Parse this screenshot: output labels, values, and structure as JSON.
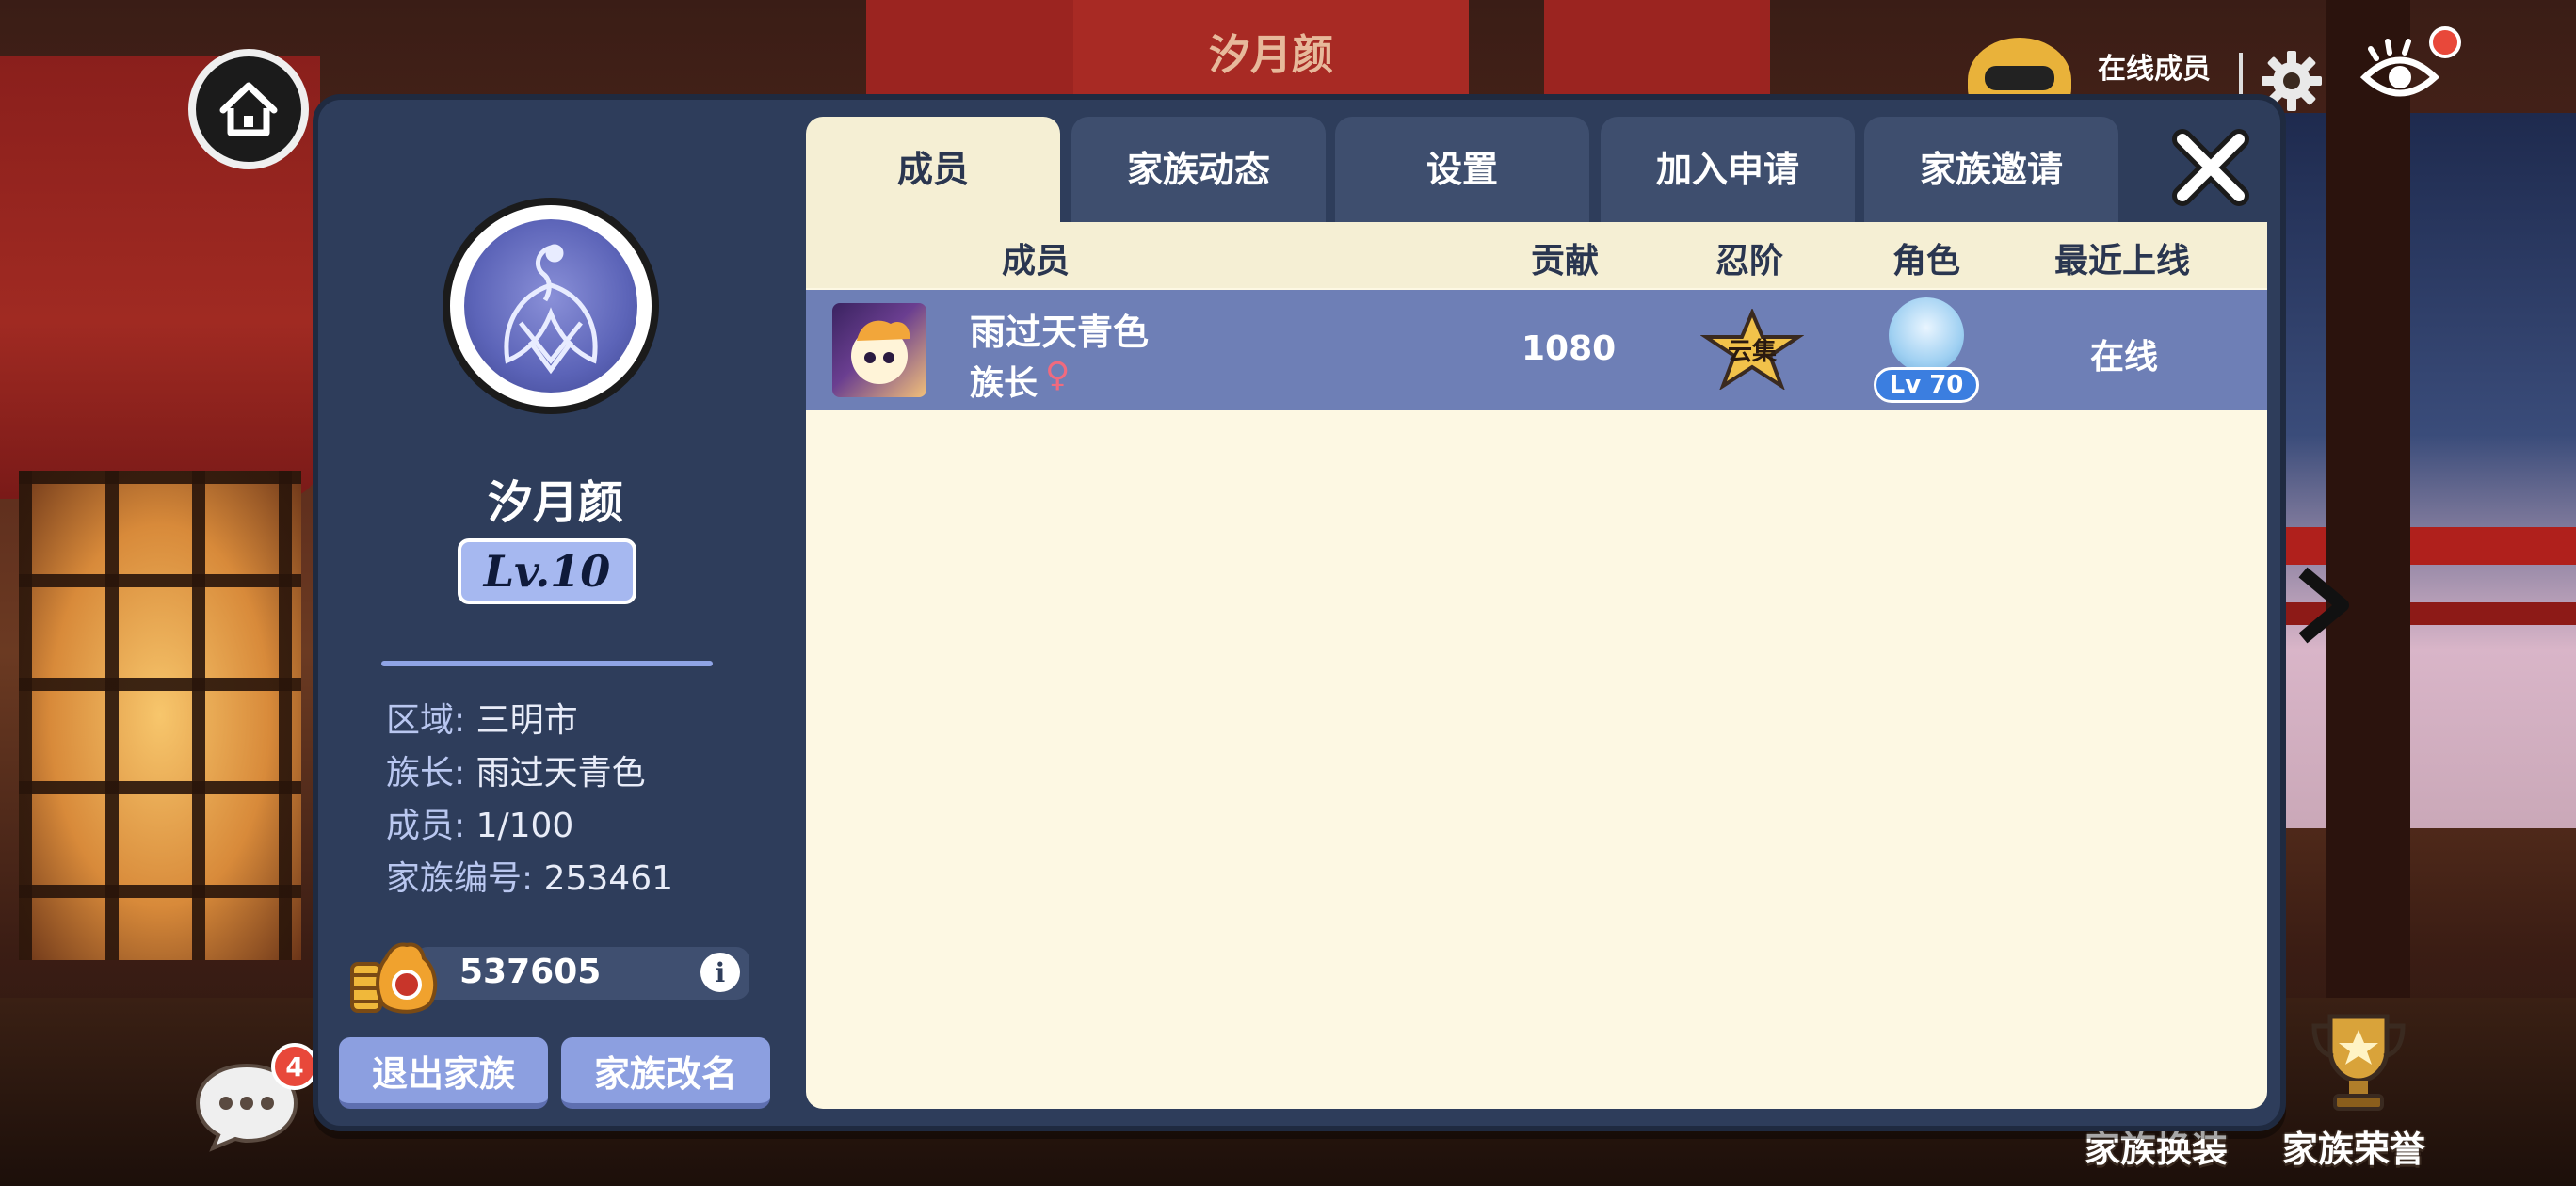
{
  "window": {
    "top_title": "汐月颜",
    "online_members_label": "在线成员"
  },
  "family": {
    "name": "汐月颜",
    "level": "Lv.10",
    "info": [
      {
        "key": "区域: ",
        "value": "三明市"
      },
      {
        "key": "族长: ",
        "value": "雨过天青色"
      },
      {
        "key": "成员: ",
        "value": "1/100"
      },
      {
        "key": "家族编号: ",
        "value": "253461"
      }
    ],
    "funds": "537605",
    "info_button": "i",
    "buttons": {
      "quit": "退出家族",
      "rename": "家族改名"
    }
  },
  "tabs": [
    {
      "label": "成员",
      "active": true
    },
    {
      "label": "家族动态",
      "active": false
    },
    {
      "label": "设置",
      "active": false
    },
    {
      "label": "加入申请",
      "active": false
    },
    {
      "label": "家族邀请",
      "active": false
    }
  ],
  "table": {
    "headers": [
      "成员",
      "贡献",
      "忍阶",
      "角色",
      "最近上线"
    ],
    "rows": [
      {
        "name": "雨过天青色",
        "role": "族长",
        "gender": "♀",
        "contribution": "1080",
        "rank_badge_text": "云集",
        "character_level": "Lv 70",
        "last_online": "在线"
      }
    ]
  },
  "hud": {
    "chat_badge_count": "4",
    "bottom_buttons": [
      "家族换装",
      "家族荣誉"
    ]
  },
  "colors": {
    "panel_bg": "#2e3d5b",
    "tab_active": "#f5efd4",
    "tab_inactive": "#3e4e6e",
    "row_highlight": "#6e7fb6",
    "table_bg": "#fdf8e3",
    "button": "#8c9fe0",
    "level_badge": "#a6b8f0",
    "female_icon": "#f06a7e",
    "notification_red": "#e8483a"
  },
  "icons": [
    "home-icon",
    "gear-icon",
    "eye-icon",
    "chat-icon",
    "close-icon",
    "chevron-right-icon",
    "money-bag-icon",
    "family-emblem-icon",
    "trophy-icon",
    "ninja-icon"
  ]
}
